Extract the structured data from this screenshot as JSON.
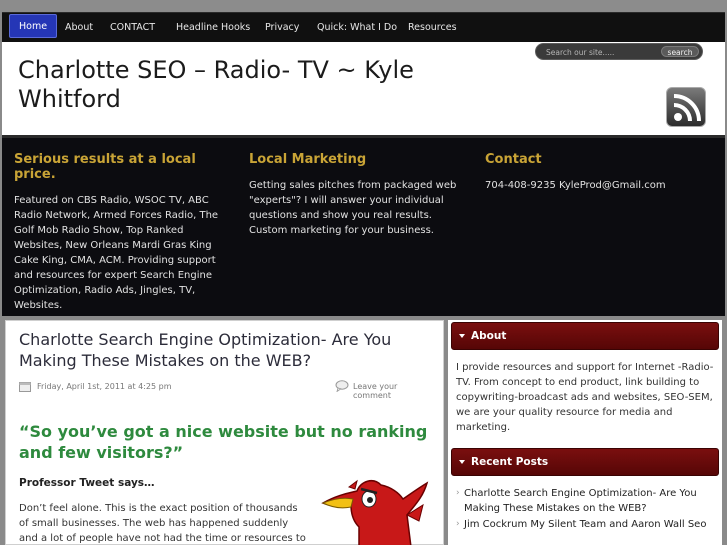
{
  "nav": {
    "items": [
      {
        "label": "Home",
        "active": true
      },
      {
        "label": "About",
        "active": false
      },
      {
        "label": "CONTACT",
        "active": false
      },
      {
        "label": "Headline Hooks",
        "active": false
      },
      {
        "label": "Privacy",
        "active": false
      },
      {
        "label": "Quick: What I Do",
        "active": false
      },
      {
        "label": "Resources",
        "active": false
      }
    ]
  },
  "header": {
    "site_title": "Charlotte SEO – Radio- TV ~ Kyle Whitford",
    "search_placeholder": "Search our site.....",
    "search_button": "search",
    "rss_icon": "rss-feed-icon"
  },
  "featured": {
    "columns": [
      {
        "title": "Serious results at a local price.",
        "text": "Featured on CBS Radio, WSOC TV, ABC Radio Network, Armed Forces Radio, The Golf Mob Radio Show, Top Ranked Websites, New Orleans Mardi Gras King Cake King, CMA, ACM. Providing support and resources for expert Search Engine Optimization, Radio Ads, Jingles, TV, Websites."
      },
      {
        "title": "Local Marketing",
        "text": "Getting sales pitches from packaged web \"experts\"? I will answer your individual questions and show you real results. Custom marketing for your business."
      },
      {
        "title": "Contact",
        "text": "704-408-9235 KyleProd@Gmail.com"
      }
    ]
  },
  "post": {
    "title": "Charlotte Search Engine Optimization- Are You Making These Mistakes on the WEB?",
    "date": "Friday, April 1st, 2011 at 4:25 pm",
    "comment_link": "Leave your comment",
    "heading": "“So you’ve got a nice website but no ranking and few visitors?”",
    "subhead": "Professor Tweet says…",
    "body": "Don’t feel alone. This is the exact position of thousands of small businesses. The web has happened suddenly and a lot of people have not had the time or resources to make"
  },
  "sidebar": {
    "about": {
      "title": "About",
      "text": "I provide resources and support for Internet -Radio- TV. From concept to end product, link building to copywriting-broadcast ads and websites, SEO-SEM, we are your quality resource for media and marketing."
    },
    "recent_posts": {
      "title": "Recent Posts",
      "items": [
        "Charlotte Search Engine Optimization- Are You Making These Mistakes on the WEB?",
        "Jim Cockrum My Silent Team and Aaron Wall Seo"
      ]
    }
  },
  "colors": {
    "nav_active": "#2536b6",
    "featured_heading": "#c9a436",
    "post_heading": "#2e8a3e",
    "widget_header": "#6a0a0a"
  }
}
